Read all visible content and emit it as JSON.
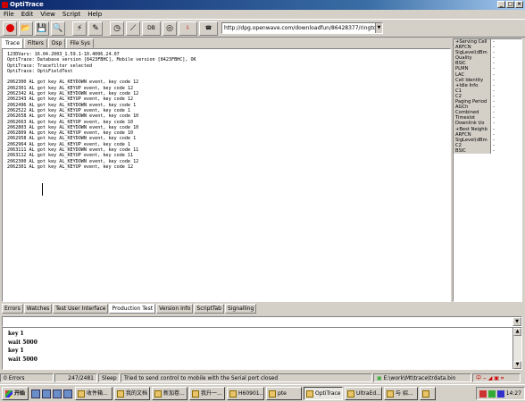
{
  "window": {
    "title": "OptiTrace"
  },
  "menu": [
    "File",
    "Edit",
    "View",
    "Script",
    "Help"
  ],
  "toolbar": {
    "db_label": "DB",
    "url": "http://dpg.openwave.com/downloadfun/86428377/ringto"
  },
  "top_tabs": [
    "Trace",
    "Filters",
    "Dsp",
    "File Sys"
  ],
  "trace_lines": [
    "123DVars: 16.04.2003_1.59.1-10.4006.24.07",
    "OptiTrace: Database version [8423FBHC], Mobile version [8423FBHC], OK",
    "OptiTrace: Tracefilter selected",
    "OptiTrace: OptiFieldTest",
    "",
    "2062300 AL got key AL_KEYDOWN event, key code 12",
    "2062301 AL got key AL_KEYUP event, key code 12",
    "2062342 AL got key AL_KEYDOWN event, key code 12",
    "2062343 AL got key AL_KEYUP event, key code 12",
    "2062496 AL got key AL_KEYDOWN event, key code 1",
    "2062522 AL got key AL_KEYUP event, key code 1",
    "2062658 AL got key AL_KEYDOWN event, key code 10",
    "2062663 AL got key AL_KEYUP event, key code 10",
    "2062803 AL got key AL_KEYDOWN event, key code 10",
    "2062809 AL got key AL_KEYUP event, key code 10",
    "2062958 AL got key AL_KEYDOWN event, key code 1",
    "2062964 AL got key AL_KEYUP event, key code 1",
    "2063111 AL got key AL_KEYDOWN event, key code 11",
    "2063112 AL got key AL_KEYUP event, key code 11",
    "2062300 AL got key AL_KEYDOWN event, key code 12",
    "2062301 AL got key AL_KEYUP event, key code 12"
  ],
  "side_panel": [
    {
      "key": "+Serving Cell",
      "val": "-"
    },
    {
      "key": "ARFCN",
      "val": "-"
    },
    {
      "key": "SigLevel(dBm",
      "val": "-"
    },
    {
      "key": "Quality",
      "val": "-"
    },
    {
      "key": "BSIC",
      "val": "-"
    },
    {
      "key": "PLMN",
      "val": "-"
    },
    {
      "key": "LAC",
      "val": "-"
    },
    {
      "key": "Cell Identity",
      "val": "-"
    },
    {
      "key": "+Idle Info",
      "val": "-"
    },
    {
      "key": "C1",
      "val": "-"
    },
    {
      "key": "C2",
      "val": "-"
    },
    {
      "key": "Paging Period",
      "val": "-"
    },
    {
      "key": "AGCh",
      "val": "-"
    },
    {
      "key": "Combined",
      "val": "-"
    },
    {
      "key": "Timeslot",
      "val": "-"
    },
    {
      "key": "Downlink t/o",
      "val": "-"
    },
    {
      "key": "+Best Neighb",
      "val": "-"
    },
    {
      "key": "ARFCN",
      "val": "-"
    },
    {
      "key": "SigLevel(dBm",
      "val": "-"
    },
    {
      "key": "C2",
      "val": "-"
    },
    {
      "key": "BSIC",
      "val": "-"
    }
  ],
  "bottom_tabs": [
    "Errors",
    "Watches",
    "Test User Interface",
    "Production Test",
    "Version Info",
    "ScriptTab",
    "Signalling"
  ],
  "active_bottom_tab": "Production Test",
  "script_lines": [
    "key 1",
    "wait 5000",
    "key 1",
    "wait 5000"
  ],
  "status": {
    "errors": "0 Errors",
    "count": "247/2481",
    "state": "Sleep",
    "message": "Tried to send control to mobile with the Serial port closed",
    "path": "E:\\work\\Mt\\trace\\trdata.bin"
  },
  "taskbar": {
    "start": "开始",
    "tasks": [
      "收件箱...",
      "我的文档",
      "新加卷...",
      "我升一...",
      "H60901...",
      "pte",
      "OptiTrace",
      "UltraEd...",
      "与 招...",
      ""
    ],
    "clock": "14:27"
  }
}
